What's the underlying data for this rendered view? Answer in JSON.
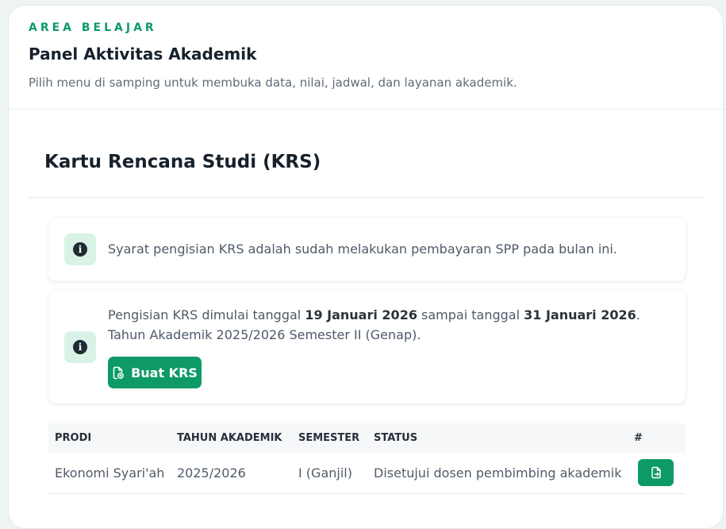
{
  "header": {
    "eyebrow": "AREA BELAJAR",
    "title": "Panel Aktivitas Akademik",
    "subtitle": "Pilih menu di samping untuk membuka data, nilai, jadwal, dan layanan akademik."
  },
  "section": {
    "title": "Kartu Rencana Studi (KRS)"
  },
  "alerts": {
    "requirement": "Syarat pengisian KRS adalah sudah melakukan pembayaran SPP pada bulan ini.",
    "period": {
      "prefix": "Pengisian KRS dimulai tanggal ",
      "start_date": "19 Januari 2026",
      "middle": " sampai tanggal ",
      "end_date": "31 Januari 2026",
      "suffix": ".",
      "academic_year": "Tahun Akademik 2025/2026 Semester II (Genap)."
    },
    "info_glyph": "i",
    "create_button_label": "Buat KRS"
  },
  "table": {
    "headers": [
      "PRODI",
      "TAHUN AKADEMIK",
      "SEMESTER",
      "STATUS",
      "#"
    ],
    "rows": [
      {
        "prodi": "Ekonomi Syari'ah",
        "tahun": "2025/2026",
        "semester": "I (Ganjil)",
        "status": "Disetujui dosen pembimbing akademik"
      }
    ]
  },
  "icons": {
    "info": "info-circle-icon",
    "create_krs": "file-plus-icon",
    "row_action": "file-export-icon"
  },
  "colors": {
    "accent": "#0e9a67",
    "info_bg": "#d8f3e6"
  }
}
